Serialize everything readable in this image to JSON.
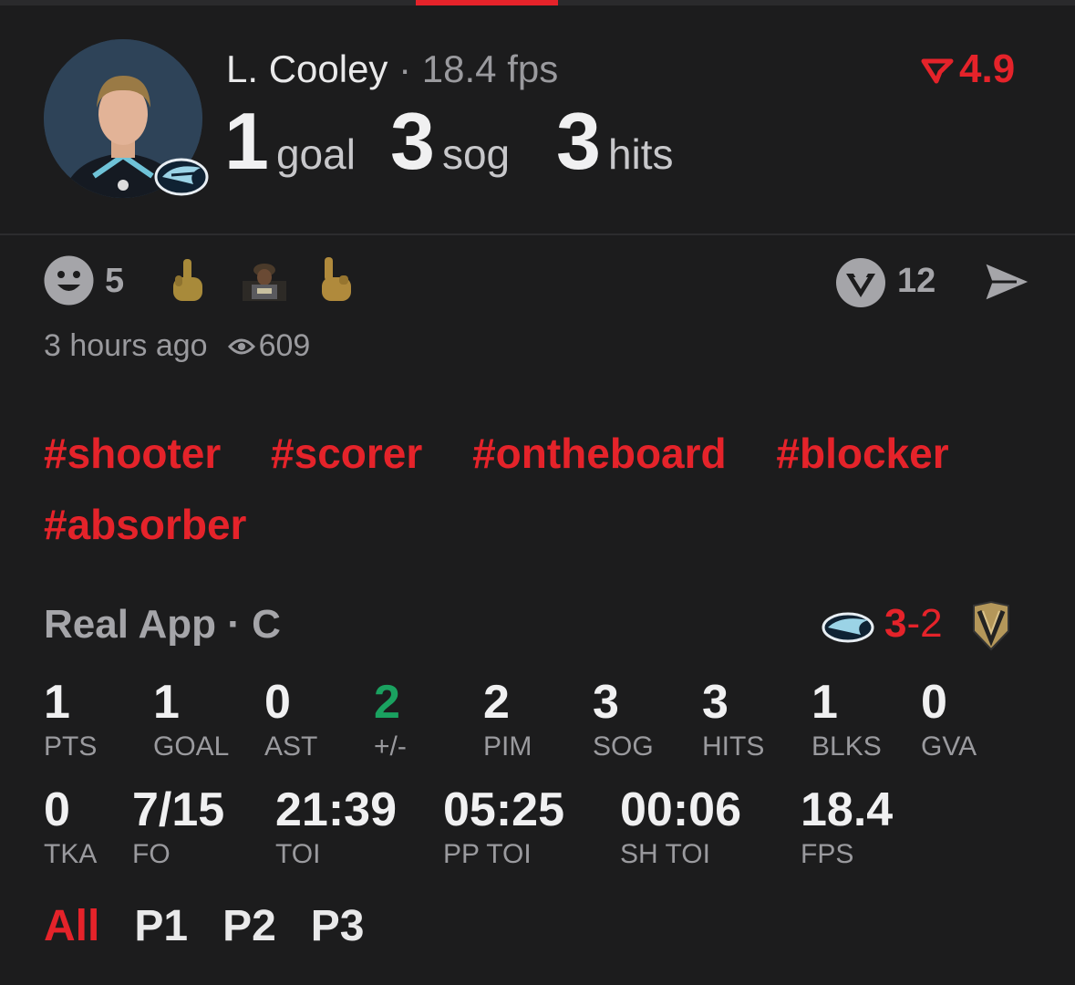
{
  "player": {
    "name": "L. Cooley",
    "separator": "·",
    "fps": "18.4 fps",
    "stats": [
      {
        "value": "1",
        "label": "goal"
      },
      {
        "value": "3",
        "label": "sog"
      },
      {
        "value": "3",
        "label": "hits"
      }
    ],
    "rating": "4.9"
  },
  "reactions": {
    "count": "5",
    "comments": "12",
    "time_ago": "3 hours ago",
    "views": "609"
  },
  "hashtags": [
    "#shooter",
    "#scorer",
    "#ontheboard",
    "#blocker",
    "#absorber"
  ],
  "game": {
    "title": "Real App · C",
    "home_score": "3",
    "dash": "-",
    "away_score": "2"
  },
  "stat_row1": [
    {
      "value": "1",
      "label": "PTS"
    },
    {
      "value": "1",
      "label": "GOAL"
    },
    {
      "value": "0",
      "label": "AST"
    },
    {
      "value": "2",
      "label": "+/-"
    },
    {
      "value": "2",
      "label": "PIM"
    },
    {
      "value": "3",
      "label": "SOG"
    },
    {
      "value": "3",
      "label": "HITS"
    },
    {
      "value": "1",
      "label": "BLKS"
    },
    {
      "value": "0",
      "label": "GVA"
    }
  ],
  "stat_row2": [
    {
      "value": "0",
      "label": "TKA"
    },
    {
      "value": "7/15",
      "label": "FO"
    },
    {
      "value": "21:39",
      "label": "TOI"
    },
    {
      "value": "05:25",
      "label": "PP TOI"
    },
    {
      "value": "00:06",
      "label": "SH TOI"
    },
    {
      "value": "18.4",
      "label": "FPS"
    }
  ],
  "periods": [
    "All",
    "P1",
    "P2",
    "P3"
  ],
  "colors": {
    "accent": "#e5232a",
    "positive": "#1aa260",
    "background": "#1c1c1d"
  }
}
